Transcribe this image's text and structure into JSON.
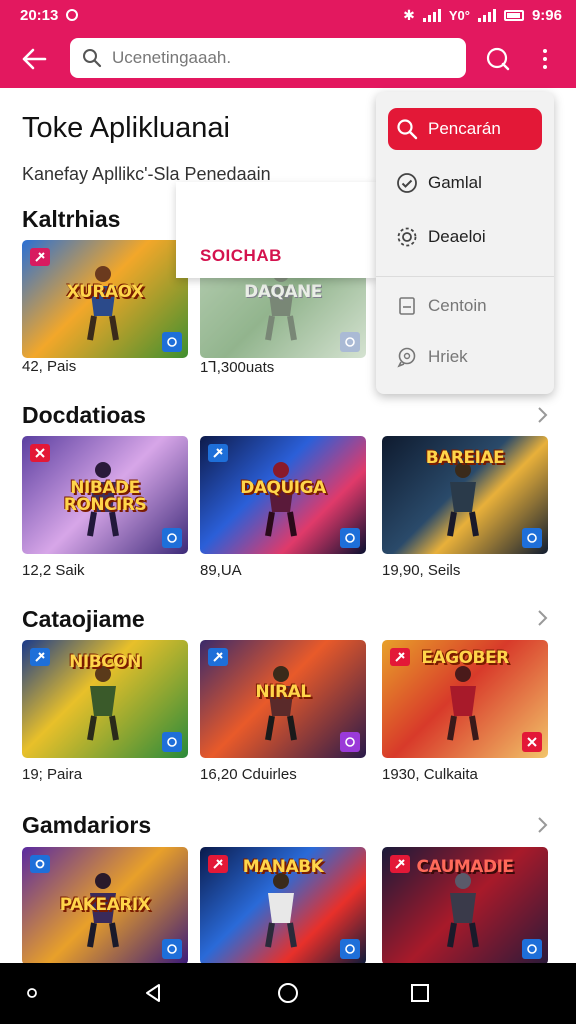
{
  "status_bar": {
    "time": "20:13",
    "battery": "9:96",
    "extra": "Y0°"
  },
  "search": {
    "placeholder": "Ucenetingaaah."
  },
  "page": {
    "title": "Toke Aplikluanai",
    "subtitle": "Kanefay Apllikc'-Sla Penedaain"
  },
  "sections": [
    {
      "title": "Kaltrhias",
      "cards": [
        {
          "art": "XURAOX",
          "caption": "42, Pais"
        },
        {
          "art": "DAQANE",
          "caption": "1Ꞁ,300uats"
        }
      ]
    },
    {
      "title": "Docdatioas",
      "cards": [
        {
          "art": "NIBADE RONCIRS",
          "caption": "12,2 Saik"
        },
        {
          "art": "DAQUIGA",
          "caption": "89,UA"
        },
        {
          "art": "BAREIAE",
          "caption": "19,90, Seils"
        }
      ]
    },
    {
      "title": "Cataojiame",
      "cards": [
        {
          "art": "NIBCON",
          "caption": "19; Paira"
        },
        {
          "art": "NIRAL",
          "caption": "16,20 Cduirles"
        },
        {
          "art": "EAGOBER",
          "caption": "1930, Culkaita"
        }
      ]
    },
    {
      "title": "Gamdariors",
      "cards": [
        {
          "art": "PAKEARIX",
          "caption": ""
        },
        {
          "art": "MANABK",
          "caption": ""
        },
        {
          "art": "CAUMADIE",
          "caption": ""
        }
      ]
    }
  ],
  "menu": {
    "items": [
      {
        "label": "Pencarán",
        "icon": "search-icon"
      },
      {
        "label": "Gamlal",
        "icon": "check-circle-icon"
      },
      {
        "label": "Deaeloi",
        "icon": "gear-icon"
      },
      {
        "label": "Centoin",
        "icon": "document-icon"
      },
      {
        "label": "Hriek",
        "icon": "chat-icon"
      }
    ]
  },
  "popup": {
    "label": "SOICHAB"
  },
  "colors": {
    "brand": "#e3185f",
    "menu_active": "#e31837",
    "popup_text": "#d4124e"
  }
}
